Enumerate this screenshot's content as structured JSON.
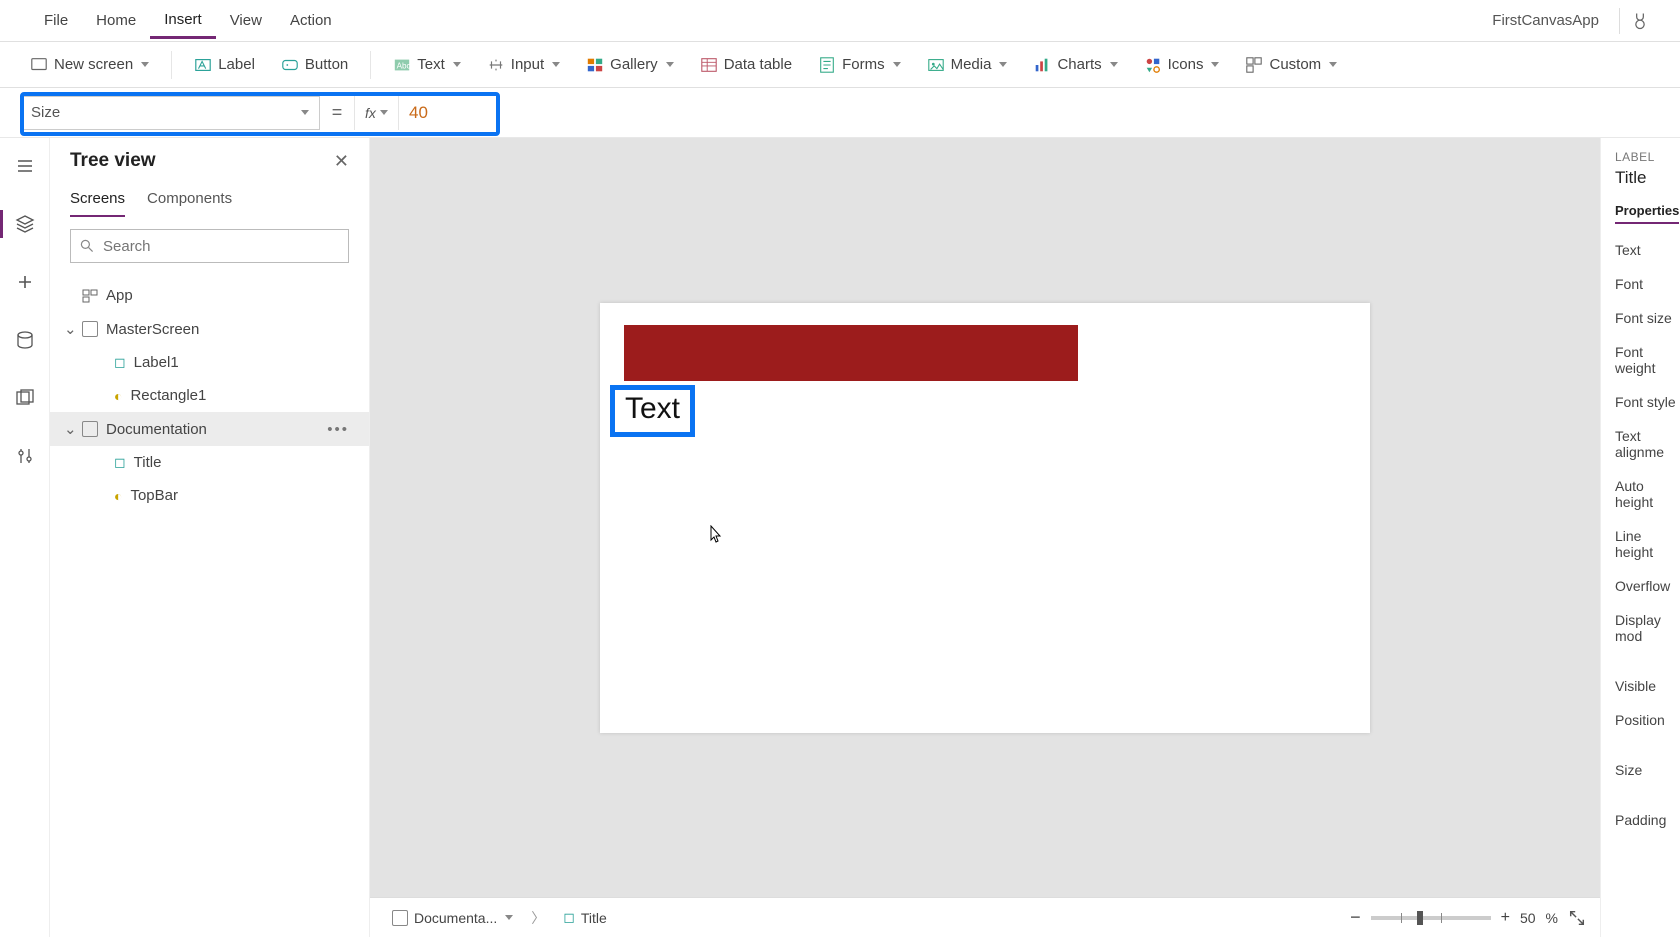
{
  "menu": {
    "items": [
      "File",
      "Home",
      "Insert",
      "View",
      "Action"
    ],
    "active": "Insert",
    "app_name": "FirstCanvasApp"
  },
  "ribbon": {
    "new_screen": "New screen",
    "label": "Label",
    "button": "Button",
    "text": "Text",
    "input": "Input",
    "gallery": "Gallery",
    "data_table": "Data table",
    "forms": "Forms",
    "media": "Media",
    "charts": "Charts",
    "icons": "Icons",
    "custom": "Custom"
  },
  "formula": {
    "property": "Size",
    "equals": "=",
    "fx": "fx",
    "value": "40"
  },
  "tree": {
    "title": "Tree view",
    "tabs": {
      "screens": "Screens",
      "components": "Components",
      "active": "Screens"
    },
    "search_placeholder": "Search",
    "app": "App",
    "items": [
      {
        "name": "MasterScreen",
        "kind": "screen",
        "children": [
          {
            "name": "Label1",
            "kind": "label"
          },
          {
            "name": "Rectangle1",
            "kind": "shape"
          }
        ]
      },
      {
        "name": "Documentation",
        "kind": "screen",
        "selected": true,
        "children": [
          {
            "name": "Title",
            "kind": "label"
          },
          {
            "name": "TopBar",
            "kind": "shape"
          }
        ]
      }
    ]
  },
  "canvas": {
    "title_text": "Text",
    "topbar_color": "#9c1c1c"
  },
  "breadcrumb": {
    "screen": "Documenta...",
    "control": "Title"
  },
  "zoom": {
    "minus": "−",
    "plus": "+",
    "value": "50",
    "unit": "%"
  },
  "props": {
    "type_label": "LABEL",
    "name": "Title",
    "tab": "Properties",
    "rows": [
      "Text",
      "Font",
      "Font size",
      "Font weight",
      "Font style",
      "Text alignme",
      "Auto height",
      "Line height",
      "Overflow",
      "Display mod",
      "Visible",
      "Position",
      "Size",
      "Padding"
    ]
  }
}
